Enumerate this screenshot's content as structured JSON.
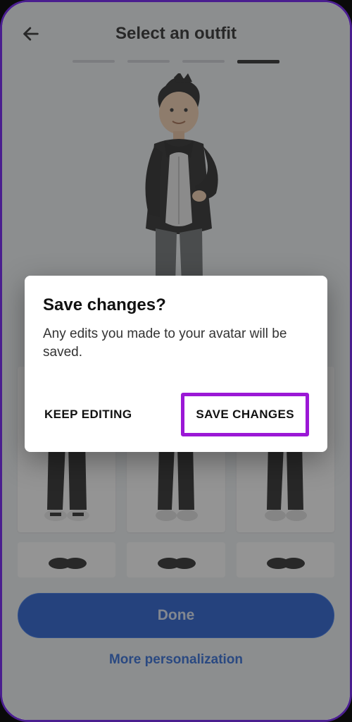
{
  "header": {
    "title": "Select an outfit",
    "back_icon": "arrow-left"
  },
  "progress": {
    "total": 4,
    "active_index": 3
  },
  "outfit_grid": {
    "items": [
      {
        "name": "outfit-1"
      },
      {
        "name": "outfit-2"
      },
      {
        "name": "outfit-3"
      }
    ]
  },
  "footer": {
    "done_label": "Done",
    "more_label": "More personalization"
  },
  "modal": {
    "title": "Save changes?",
    "body": "Any edits you made to your avatar will be saved.",
    "keep_label": "KEEP EDITING",
    "save_label": "SAVE CHANGES"
  },
  "highlight": {
    "color": "#9b18d6"
  }
}
